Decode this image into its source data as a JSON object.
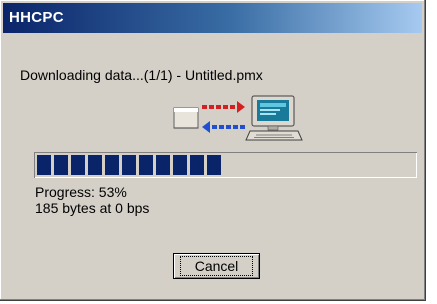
{
  "window": {
    "title": "HHCPC"
  },
  "status": {
    "message": "Downloading data...(1/1) - Untitled.pmx"
  },
  "transfer_icon": {
    "name": "download-transfer-icon",
    "colors": {
      "arrow_out": "#d42020",
      "arrow_in": "#2050d0"
    }
  },
  "progress": {
    "fraction": 0.53,
    "label": "Progress: 53%",
    "bytes_label": "185 bytes at 0 bps",
    "bar_color": "#0a246a"
  },
  "buttons": {
    "cancel_label": "Cancel"
  }
}
